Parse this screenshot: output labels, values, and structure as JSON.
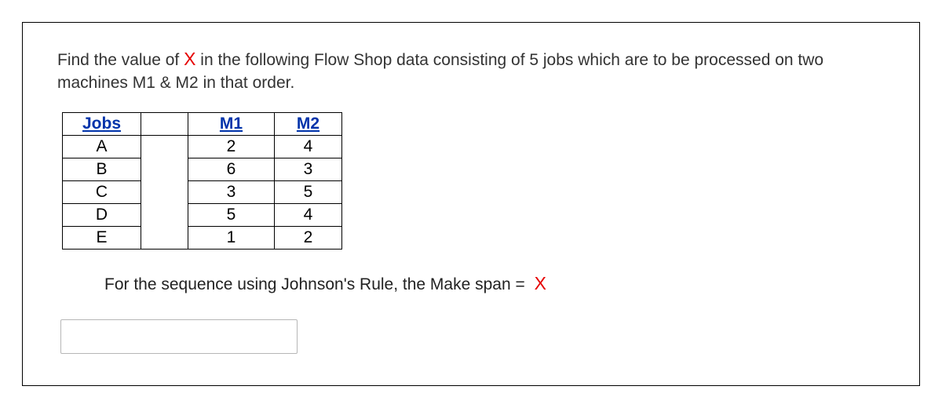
{
  "question": {
    "prefix": "Find the value of ",
    "xvar": "X",
    "suffix": " in the following Flow Shop data consisting of 5 jobs which are to be processed on two machines M1 & M2 in that order."
  },
  "table": {
    "headers": {
      "jobs": "Jobs",
      "m1": "M1",
      "m2": "M2"
    },
    "rows": [
      {
        "job": "A",
        "m1": "2",
        "m2": "4"
      },
      {
        "job": "B",
        "m1": "6",
        "m2": "3"
      },
      {
        "job": "C",
        "m1": "3",
        "m2": "5"
      },
      {
        "job": "D",
        "m1": "5",
        "m2": "4"
      },
      {
        "job": "E",
        "m1": "1",
        "m2": "2"
      }
    ]
  },
  "answer_line": {
    "text": "For the sequence using Johnson's Rule, the Make span =",
    "x": "X"
  },
  "input": {
    "value": ""
  }
}
